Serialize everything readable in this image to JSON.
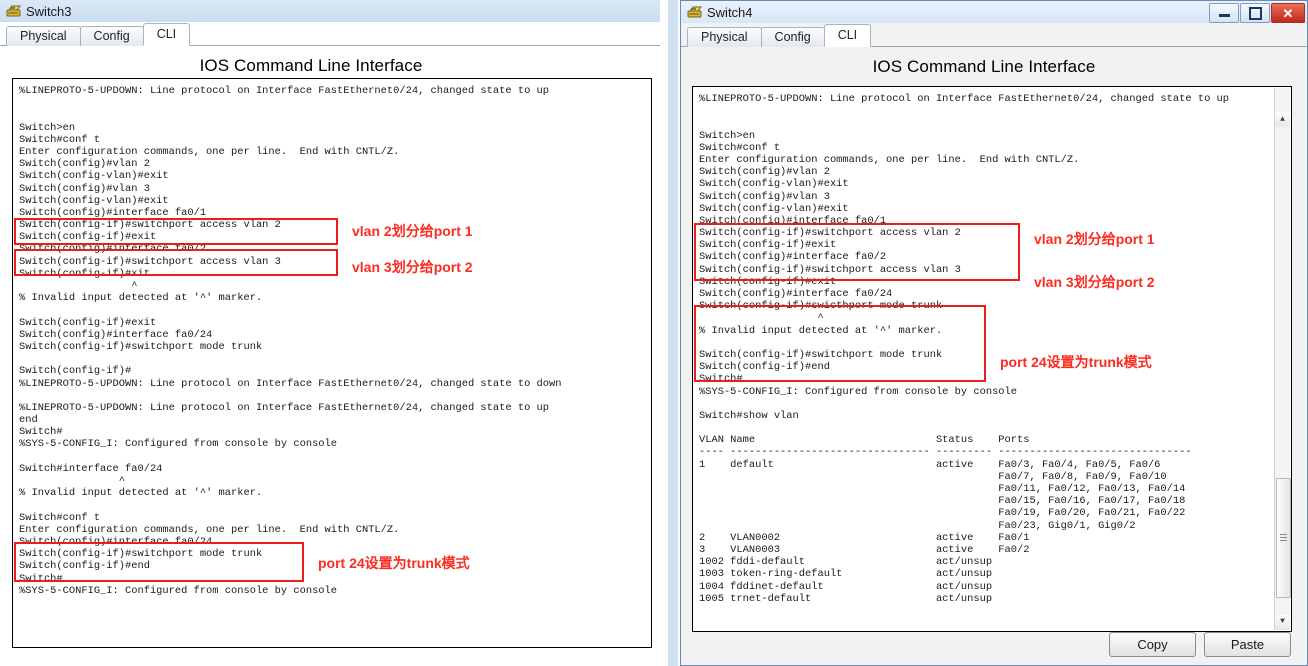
{
  "left_window": {
    "title": "Switch3",
    "icon": "switch-device-icon",
    "tabs": [
      {
        "label": "Physical",
        "active": false
      },
      {
        "label": "Config",
        "active": false
      },
      {
        "label": "CLI",
        "active": true
      }
    ],
    "header": "IOS Command Line Interface",
    "console_lines": [
      "%LINEPROTO-5-UPDOWN: Line protocol on Interface FastEthernet0/24, changed state to up",
      "",
      "",
      "Switch>en",
      "Switch#conf t",
      "Enter configuration commands, one per line.  End with CNTL/Z.",
      "Switch(config)#vlan 2",
      "Switch(config-vlan)#exit",
      "Switch(config)#vlan 3",
      "Switch(config-vlan)#exit",
      "Switch(config)#interface fa0/1",
      "Switch(config-if)#switchport access vlan 2",
      "Switch(config-if)#exit",
      "Switch(config)#interface fa0/2",
      "Switch(config-if)#switchport access vlan 3",
      "Switch(config-if)#xit",
      "                  ^",
      "% Invalid input detected at '^' marker.",
      "",
      "Switch(config-if)#exit",
      "Switch(config)#interface fa0/24",
      "Switch(config-if)#switchport mode trunk",
      "",
      "Switch(config-if)#",
      "%LINEPROTO-5-UPDOWN: Line protocol on Interface FastEthernet0/24, changed state to down",
      "",
      "%LINEPROTO-5-UPDOWN: Line protocol on Interface FastEthernet0/24, changed state to up",
      "end",
      "Switch#",
      "%SYS-5-CONFIG_I: Configured from console by console",
      "",
      "Switch#interface fa0/24",
      "                ^",
      "% Invalid input detected at '^' marker.",
      "",
      "Switch#conf t",
      "Enter configuration commands, one per line.  End with CNTL/Z.",
      "Switch(config)#interface fa0/24",
      "Switch(config-if)#switchport mode trunk",
      "Switch(config-if)#end",
      "Switch#",
      "%SYS-5-CONFIG_I: Configured from console by console"
    ],
    "annotations": [
      {
        "name": "annotation-vlan2-port1",
        "text": "vlan 2划分给port 1"
      },
      {
        "name": "annotation-vlan3-port2",
        "text": "vlan 3划分给port 2"
      },
      {
        "name": "annotation-port24-trunk",
        "text": "port 24设置为trunk模式"
      }
    ]
  },
  "right_window": {
    "title": "Switch4",
    "icon": "switch-device-icon",
    "window_buttons": [
      {
        "name": "minimize-button",
        "glyph": "—"
      },
      {
        "name": "maximize-button",
        "glyph": "▣"
      },
      {
        "name": "close-button",
        "glyph": "✕"
      }
    ],
    "tabs": [
      {
        "label": "Physical",
        "active": false
      },
      {
        "label": "Config",
        "active": false
      },
      {
        "label": "CLI",
        "active": true
      }
    ],
    "header": "IOS Command Line Interface",
    "console_lines": [
      "%LINEPROTO-5-UPDOWN: Line protocol on Interface FastEthernet0/24, changed state to up",
      "",
      "",
      "Switch>en",
      "Switch#conf t",
      "Enter configuration commands, one per line.  End with CNTL/Z.",
      "Switch(config)#vlan 2",
      "Switch(config-vlan)#exit",
      "Switch(config)#vlan 3",
      "Switch(config-vlan)#exit",
      "Switch(config)#interface fa0/1",
      "Switch(config-if)#switchport access vlan 2",
      "Switch(config-if)#exit",
      "Switch(config)#interface fa0/2",
      "Switch(config-if)#switchport access vlan 3",
      "Switch(config-if)#exit",
      "Switch(config)#interface fa0/24",
      "Switch(config-if)#swicthport mode trunk",
      "                   ^",
      "% Invalid input detected at '^' marker.",
      "",
      "Switch(config-if)#switchport mode trunk",
      "Switch(config-if)#end",
      "Switch#",
      "%SYS-5-CONFIG_I: Configured from console by console",
      "",
      "Switch#show vlan",
      "",
      "VLAN Name                             Status    Ports",
      "---- -------------------------------- --------- -------------------------------",
      "1    default                          active    Fa0/3, Fa0/4, Fa0/5, Fa0/6",
      "                                                Fa0/7, Fa0/8, Fa0/9, Fa0/10",
      "                                                Fa0/11, Fa0/12, Fa0/13, Fa0/14",
      "                                                Fa0/15, Fa0/16, Fa0/17, Fa0/18",
      "                                                Fa0/19, Fa0/20, Fa0/21, Fa0/22",
      "                                                Fa0/23, Gig0/1, Gig0/2",
      "2    VLAN0002                         active    Fa0/1",
      "3    VLAN0003                         active    Fa0/2",
      "1002 fddi-default                     act/unsup",
      "1003 token-ring-default               act/unsup",
      "1004 fddinet-default                  act/unsup",
      "1005 trnet-default                    act/unsup"
    ],
    "vlan_table": {
      "columns": [
        "VLAN",
        "Name",
        "Status",
        "Ports"
      ],
      "rows": [
        {
          "vlan": "1",
          "name": "default",
          "status": "active",
          "ports": "Fa0/3, Fa0/4, Fa0/5, Fa0/6, Fa0/7, Fa0/8, Fa0/9, Fa0/10, Fa0/11, Fa0/12, Fa0/13, Fa0/14, Fa0/15, Fa0/16, Fa0/17, Fa0/18, Fa0/19, Fa0/20, Fa0/21, Fa0/22, Fa0/23, Gig0/1, Gig0/2"
        },
        {
          "vlan": "2",
          "name": "VLAN0002",
          "status": "active",
          "ports": "Fa0/1"
        },
        {
          "vlan": "3",
          "name": "VLAN0003",
          "status": "active",
          "ports": "Fa0/2"
        },
        {
          "vlan": "1002",
          "name": "fddi-default",
          "status": "act/unsup",
          "ports": ""
        },
        {
          "vlan": "1003",
          "name": "token-ring-default",
          "status": "act/unsup",
          "ports": ""
        },
        {
          "vlan": "1004",
          "name": "fddinet-default",
          "status": "act/unsup",
          "ports": ""
        },
        {
          "vlan": "1005",
          "name": "trnet-default",
          "status": "act/unsup",
          "ports": ""
        }
      ]
    },
    "annotations": [
      {
        "name": "annotation-vlan2-port1",
        "text": "vlan 2划分给port 1"
      },
      {
        "name": "annotation-vlan3-port2",
        "text": "vlan 3划分给port 2"
      },
      {
        "name": "annotation-port24-trunk",
        "text": "port 24设置为trunk模式"
      }
    ],
    "buttons": [
      {
        "name": "copy-button",
        "label": "Copy"
      },
      {
        "name": "paste-button",
        "label": "Paste"
      }
    ],
    "scrollbar": {
      "up_arrow": "▲",
      "down_arrow": "▼"
    }
  },
  "colors": {
    "annotation_red": "#fb2c20",
    "box_red": "#ee1d1d",
    "titlebar_blue": "#cfe0f0",
    "close_red": "#c0281b"
  }
}
